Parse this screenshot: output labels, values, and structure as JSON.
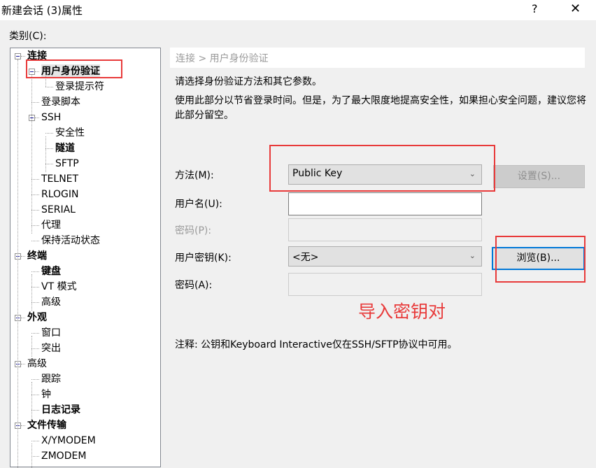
{
  "window": {
    "title": "新建会话 (3)属性",
    "help_label": "?",
    "close_label": "✕"
  },
  "category": {
    "label": "类别(C):",
    "tree": [
      {
        "label": "连接",
        "level": 0,
        "bold": true,
        "expander": true
      },
      {
        "label": "用户身份验证",
        "level": 1,
        "bold": true,
        "expander": true,
        "selected": true
      },
      {
        "label": "登录提示符",
        "level": 2,
        "bold": false
      },
      {
        "label": "登录脚本",
        "level": 1,
        "bold": false
      },
      {
        "label": "SSH",
        "level": 1,
        "bold": false,
        "expander": true
      },
      {
        "label": "安全性",
        "level": 2,
        "bold": false
      },
      {
        "label": "隧道",
        "level": 2,
        "bold": true
      },
      {
        "label": "SFTP",
        "level": 2,
        "bold": false
      },
      {
        "label": "TELNET",
        "level": 1,
        "bold": false
      },
      {
        "label": "RLOGIN",
        "level": 1,
        "bold": false
      },
      {
        "label": "SERIAL",
        "level": 1,
        "bold": false
      },
      {
        "label": "代理",
        "level": 1,
        "bold": false
      },
      {
        "label": "保持活动状态",
        "level": 1,
        "bold": false
      },
      {
        "label": "终端",
        "level": 0,
        "bold": true,
        "expander": true
      },
      {
        "label": "键盘",
        "level": 1,
        "bold": true
      },
      {
        "label": "VT 模式",
        "level": 1,
        "bold": false
      },
      {
        "label": "高级",
        "level": 1,
        "bold": false
      },
      {
        "label": "外观",
        "level": 0,
        "bold": true,
        "expander": true
      },
      {
        "label": "窗口",
        "level": 1,
        "bold": false
      },
      {
        "label": "突出",
        "level": 1,
        "bold": false
      },
      {
        "label": "高级",
        "level": 0,
        "bold": false,
        "expander": true
      },
      {
        "label": "跟踪",
        "level": 1,
        "bold": false
      },
      {
        "label": "钟",
        "level": 1,
        "bold": false
      },
      {
        "label": "日志记录",
        "level": 1,
        "bold": true
      },
      {
        "label": "文件传输",
        "level": 0,
        "bold": true,
        "expander": true
      },
      {
        "label": "X/YMODEM",
        "level": 1,
        "bold": false
      },
      {
        "label": "ZMODEM",
        "level": 1,
        "bold": false
      }
    ]
  },
  "panel": {
    "breadcrumb": "连接 > 用户身份验证",
    "intro": "请选择身份验证方法和其它参数。",
    "description": "使用此部分以节省登录时间。但是，为了最大限度地提高安全性，如果担心安全问题，建议您将此部分留空。",
    "method_label": "方法(M):",
    "method_value": "Public Key",
    "settings_button": "设置(S)...",
    "username_label": "用户名(U):",
    "username_value": "",
    "password_label": "密码(P):",
    "password_value": "",
    "user_key_label": "用户密钥(K):",
    "user_key_value": "<无>",
    "browse_button": "浏览(B)...",
    "passphrase_label": "密码(A):",
    "passphrase_value": "",
    "annotation": "导入密钥对",
    "note": "注释: 公钥和Keyboard Interactive仅在SSH/SFTP协议中可用。"
  },
  "colors": {
    "annotation_red": "#e83a3a",
    "focus_blue": "#0078d7"
  }
}
